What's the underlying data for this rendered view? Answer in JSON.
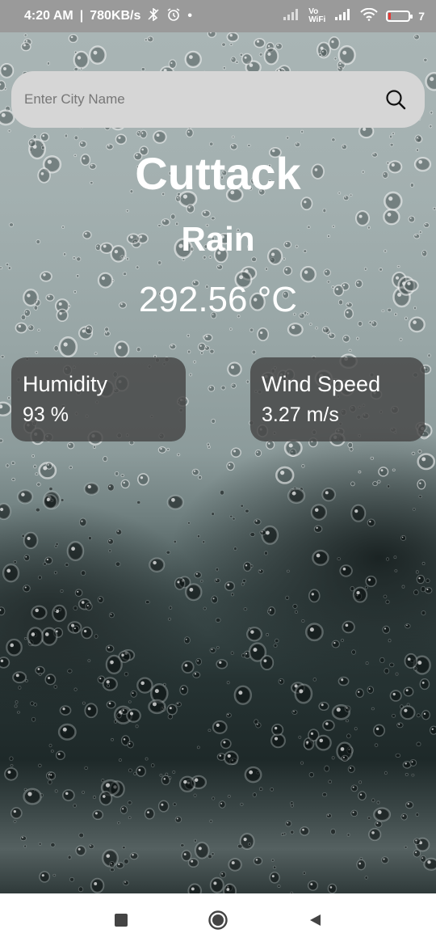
{
  "status_bar": {
    "time": "4:20 AM",
    "speed": "780KB/s",
    "network_label": "Vo WiFi",
    "battery_percent": "7",
    "icons": [
      "bluetooth-off-icon",
      "alarm-icon",
      "dot-icon",
      "signal-icon",
      "wifi-icon",
      "battery-icon"
    ]
  },
  "search": {
    "placeholder": "Enter City Name",
    "icon": "search-icon"
  },
  "weather": {
    "city": "Cuttack",
    "condition": "Rain",
    "temperature": "292.56 °C"
  },
  "cards": {
    "humidity": {
      "label": "Humidity",
      "value": "93 %"
    },
    "wind": {
      "label": "Wind Speed",
      "value": "3.27 m/s"
    }
  },
  "nav": {
    "icons": [
      "recents-icon",
      "home-icon",
      "back-icon"
    ]
  },
  "colors": {
    "status_bar": "#9a9a9a",
    "search_bg": "#d6d6d6",
    "card_bg": "#464646",
    "text": "#ffffff",
    "battery_low": "#e53935"
  }
}
